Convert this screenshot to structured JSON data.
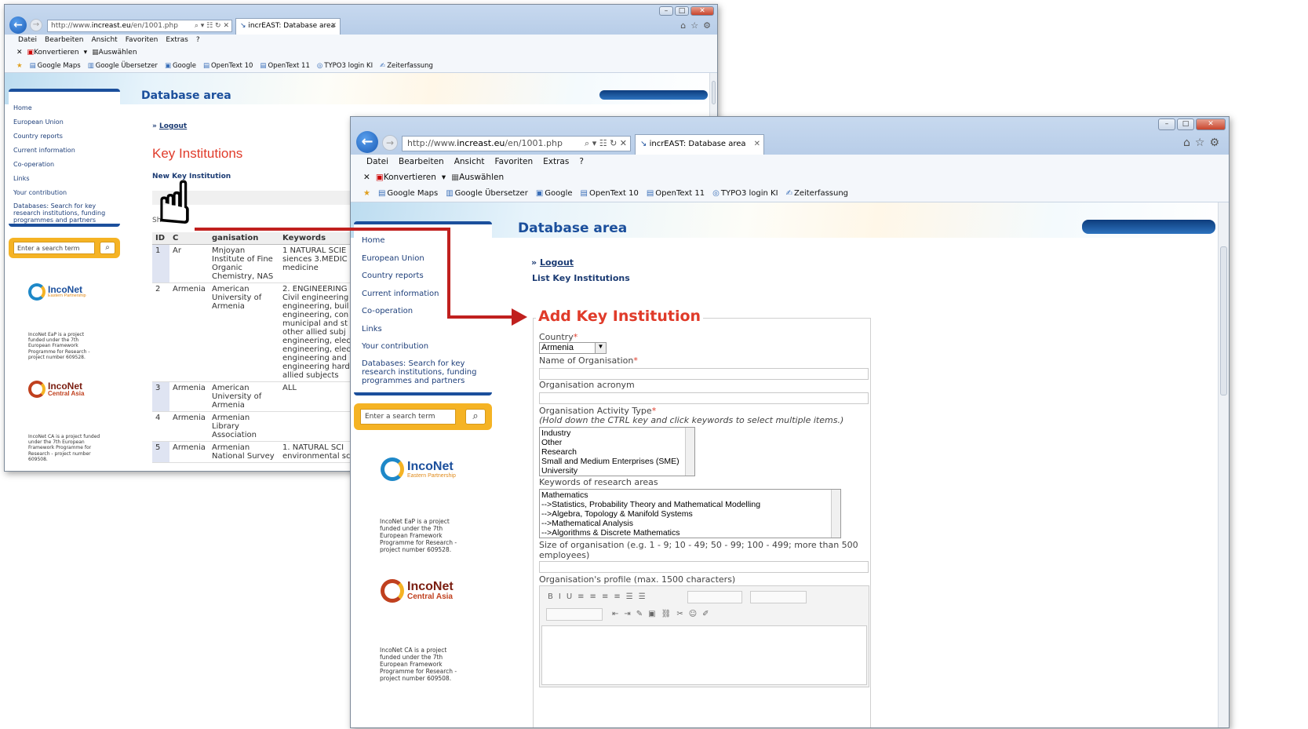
{
  "browser": {
    "url_prefix": "http://www.",
    "url_domain": "increast.eu",
    "url_path": "/en/1001.php",
    "tab_title": "incrEAST: Database area",
    "address_tools": "⌕ ▾ ☷ ↻ ✕",
    "back_glyph": "←",
    "fwd_glyph": "→",
    "tab_icon": "↘",
    "home_glyph": "⌂",
    "star_glyph": "☆",
    "gear_glyph": "⚙",
    "minimize_glyph": "–",
    "maximize_glyph": "□",
    "close_glyph": "✕",
    "tab_close_glyph": "✕",
    "menu": [
      "Datei",
      "Bearbeiten",
      "Ansicht",
      "Favoriten",
      "Extras",
      "?"
    ],
    "cmd_close": "✕",
    "cmd_konvertieren": "Konvertieren",
    "cmd_arrow": "▾",
    "cmd_auswaehlen": "Auswählen",
    "favorites": [
      "Google Maps",
      "Google Übersetzer",
      "Google",
      "OpenText 10",
      "OpenText 11",
      "TYPO3 login KI",
      "Zeiterfassung"
    ]
  },
  "site": {
    "heading": "Database area",
    "logout_prefix": "»",
    "logout": "Logout",
    "nav": [
      "Home",
      "European Union",
      "Country reports",
      "Current information",
      "Co-operation",
      "Links",
      "Your contribution",
      "Databases: Search for key research institutions, funding programmes and partners"
    ],
    "search_placeholder": "Enter a search term",
    "search_glyph": "⌕",
    "logo1_big": "IncoNet",
    "logo1_small": "Eastern Partnership",
    "logo1_text": "IncoNet EaP is a project funded under the 7th European Framework Programme for Research - project number 609528.",
    "logo2_big": "IncoNet",
    "logo2_small": "Central Asia",
    "logo2_text": "IncoNet CA is a project funded under the 7th European Framework Programme for Research - project number 609508."
  },
  "back_window": {
    "title": "Key Institutions",
    "new_link": "New Key Institution",
    "show_label": "Sh",
    "columns": [
      "ID",
      "C",
      "ganisation",
      "Keywords"
    ],
    "rows": [
      {
        "id": "1",
        "country": "Ar",
        "org": "Mnjoyan Institute of Fine Organic Chemistry, NAS",
        "kw": "1 NATURAL SCIE siences 3.MEDIC medicine"
      },
      {
        "id": "2",
        "country": "Armenia",
        "org": "American University of Armenia",
        "kw": "2. ENGINEERING Civil engineering engineering, buil engineering, con municipal and st other allied subj engineering, elec engineering, elec engineering and engineering hard allied subjects"
      },
      {
        "id": "3",
        "country": "Armenia",
        "org": "American University of Armenia",
        "kw": "ALL"
      },
      {
        "id": "4",
        "country": "Armenia",
        "org": "Armenian Library Association",
        "kw": ""
      },
      {
        "id": "5",
        "country": "Armenia",
        "org": "Armenian National Survey",
        "kw": "1. NATURAL SCI environmental sci"
      }
    ],
    "cursor_glyph": "☝"
  },
  "front_window": {
    "list_link": "List Key Institutions",
    "form_title": "Add Key Institution",
    "country_label": "Country",
    "required_mark": "*",
    "country_value": "Armenia",
    "dropdown_arrow": "▼",
    "name_label": "Name of Organisation",
    "acronym_label": "Organisation acronym",
    "activity_label": "Organisation Activity Type",
    "activity_hint": "(Hold down the CTRL key and click keywords to select multiple items.)",
    "activity_options": [
      "Industry",
      "Other",
      "Research",
      "Small and Medium Enterprises (SME)",
      "University"
    ],
    "keywords_label": "Keywords of research areas",
    "keywords_options": [
      "Mathematics",
      "-->Statistics, Probability Theory and Mathematical Modelling",
      "-->Algebra, Topology & Manifold Systems",
      "-->Mathematical Analysis",
      "-->Algorithms & Discrete Mathematics"
    ],
    "size_label": "Size of organisation (e.g. 1 - 9; 10 - 49; 50 - 99; 100 - 499; more than 500 employees)",
    "profile_label": "Organisation's profile (max. 1500 characters)",
    "editor_tools_1": [
      "B",
      "I",
      "U",
      "≡",
      "≡",
      "≡",
      "≡",
      "☰",
      "☰"
    ],
    "editor_tools_2": [
      "⇤",
      "⇥",
      "✎",
      "▣",
      "⛓",
      "✂",
      "☺",
      "✐"
    ]
  },
  "colors": {
    "brand_blue": "#1b4f9c",
    "accent_red": "#e03b2a",
    "arrow_red": "#c0201e",
    "search_orange": "#f5b324"
  }
}
